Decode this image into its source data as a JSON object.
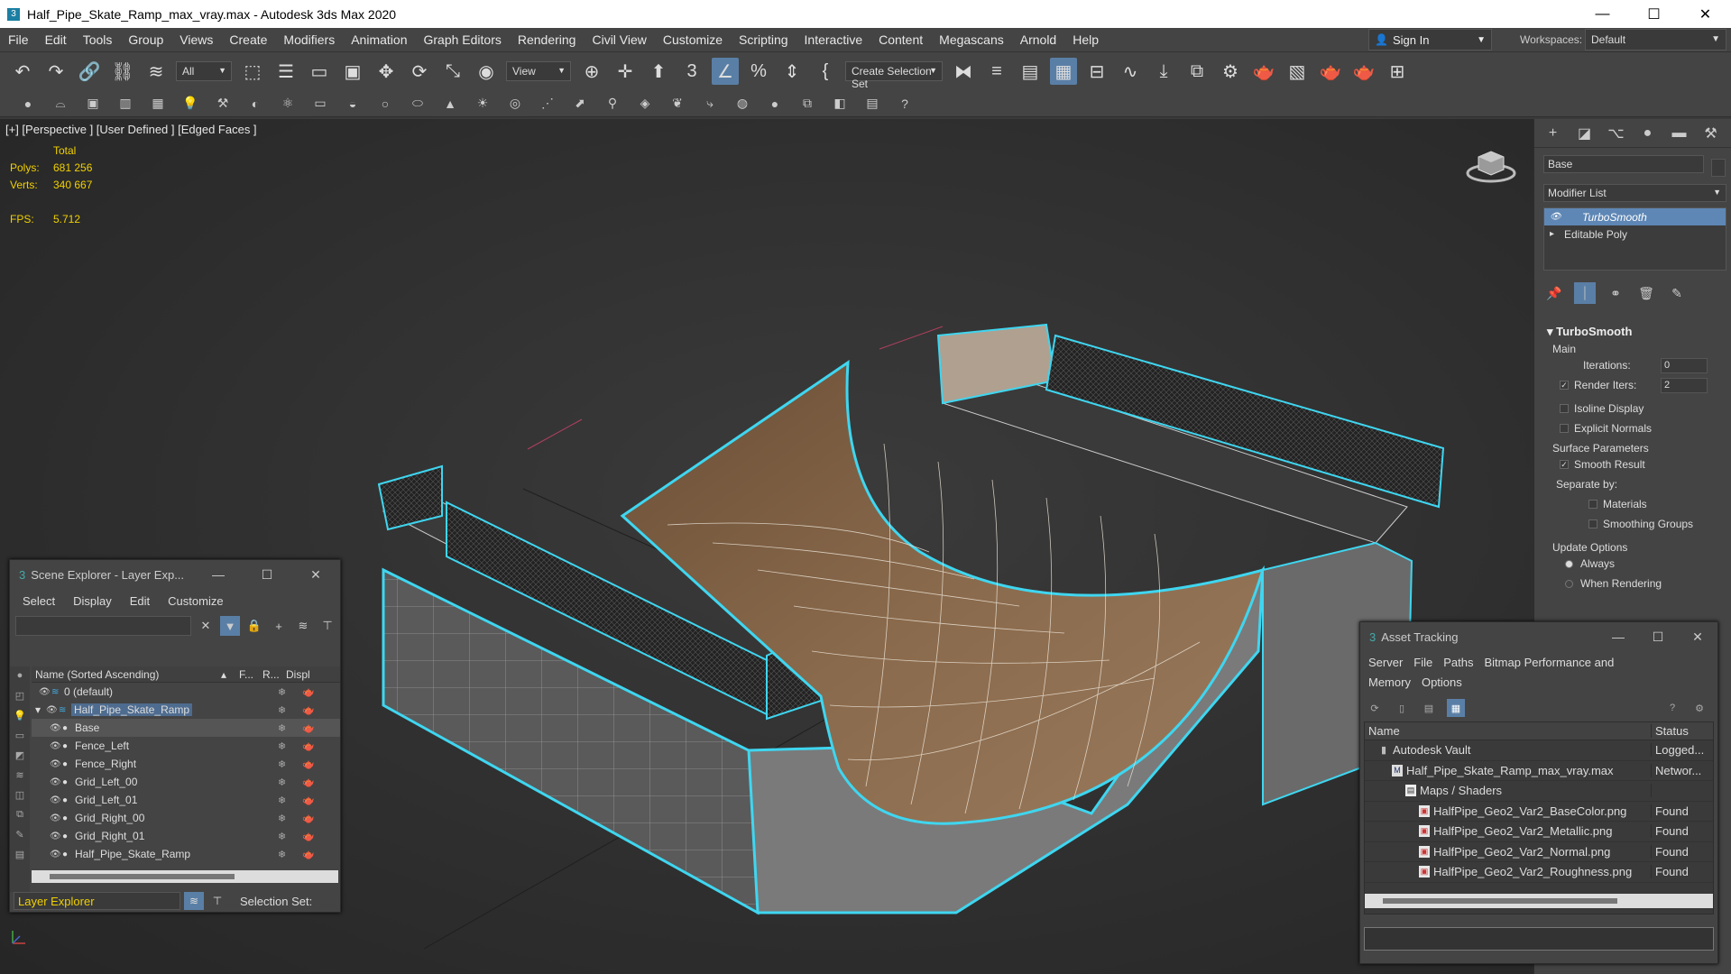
{
  "window": {
    "title": "Half_Pipe_Skate_Ramp_max_vray.max - Autodesk 3ds Max 2020",
    "minimize": "—",
    "maximize": "☐",
    "close": "✕"
  },
  "menubar": {
    "items": [
      "File",
      "Edit",
      "Tools",
      "Group",
      "Views",
      "Create",
      "Modifiers",
      "Animation",
      "Graph Editors",
      "Rendering",
      "Civil View",
      "Customize",
      "Scripting",
      "Interactive",
      "Content",
      "Megascans",
      "Arnold",
      "Help"
    ],
    "sign_in": "Sign In",
    "workspaces_label": "Workspaces:",
    "workspaces_value": "Default"
  },
  "toolbar": {
    "selection_filter": "All",
    "ref_coord": "View",
    "selection_set": "Create Selection Set"
  },
  "viewport": {
    "label": "[+] [Perspective ] [User Defined ] [Edged Faces ]",
    "stats_header": "Total",
    "polys_label": "Polys:",
    "polys_value": "681 256",
    "verts_label": "Verts:",
    "verts_value": "340 667",
    "fps_label": "FPS:",
    "fps_value": "5.712"
  },
  "command_panel": {
    "object_name": "Base",
    "modifier_list": "Modifier List",
    "stack": [
      "TurboSmooth",
      "Editable Poly"
    ],
    "rollout_title": "TurboSmooth",
    "main_label": "Main",
    "iterations_label": "Iterations:",
    "iterations_value": "0",
    "render_iters_label": "Render Iters:",
    "render_iters_value": "2",
    "isoline_display": "Isoline Display",
    "explicit_normals": "Explicit Normals",
    "surface_parameters": "Surface Parameters",
    "smooth_result": "Smooth Result",
    "separate_by": "Separate by:",
    "materials": "Materials",
    "smoothing_groups": "Smoothing Groups",
    "update_options": "Update Options",
    "always": "Always",
    "when_rendering": "When Rendering"
  },
  "scene_explorer": {
    "title": "Scene Explorer - Layer Exp...",
    "menu": [
      "Select",
      "Display",
      "Edit",
      "Customize"
    ],
    "col_name": "Name (Sorted Ascending)",
    "col_frozen": "F...",
    "col_render": "R...",
    "col_display": "Displ",
    "rows": [
      {
        "name": "0 (default)",
        "indent": 1
      },
      {
        "name": "Half_Pipe_Skate_Ramp",
        "indent": 0
      },
      {
        "name": "Base",
        "indent": 2
      },
      {
        "name": "Fence_Left",
        "indent": 2
      },
      {
        "name": "Fence_Right",
        "indent": 2
      },
      {
        "name": "Grid_Left_00",
        "indent": 2
      },
      {
        "name": "Grid_Left_01",
        "indent": 2
      },
      {
        "name": "Grid_Right_00",
        "indent": 2
      },
      {
        "name": "Grid_Right_01",
        "indent": 2
      },
      {
        "name": "Half_Pipe_Skate_Ramp",
        "indent": 2
      }
    ],
    "layer_explorer": "Layer Explorer",
    "selection_set_label": "Selection Set:"
  },
  "asset_tracking": {
    "title": "Asset Tracking",
    "menu": [
      "Server",
      "File",
      "Paths",
      "Bitmap Performance and Memory",
      "Options"
    ],
    "col_name": "Name",
    "col_status": "Status",
    "rows": [
      {
        "name": "Autodesk Vault",
        "status": "Logged...",
        "icon": "vault",
        "indent": 1
      },
      {
        "name": "Half_Pipe_Skate_Ramp_max_vray.max",
        "status": "Networ...",
        "icon": "max",
        "indent": 2
      },
      {
        "name": "Maps / Shaders",
        "status": "",
        "icon": "dir",
        "indent": 3
      },
      {
        "name": "HalfPipe_Geo2_Var2_BaseColor.png",
        "status": "Found",
        "icon": "png",
        "indent": 4
      },
      {
        "name": "HalfPipe_Geo2_Var2_Metallic.png",
        "status": "Found",
        "icon": "png",
        "indent": 4
      },
      {
        "name": "HalfPipe_Geo2_Var2_Normal.png",
        "status": "Found",
        "icon": "png",
        "indent": 4
      },
      {
        "name": "HalfPipe_Geo2_Var2_Roughness.png",
        "status": "Found",
        "icon": "png",
        "indent": 4
      }
    ]
  },
  "colors": {
    "selection_cyan": "#3fd6f0",
    "stats_yellow": "#f0d000",
    "accent_blue": "#5e87b5",
    "ramp_brown": "#7a5a3e"
  }
}
